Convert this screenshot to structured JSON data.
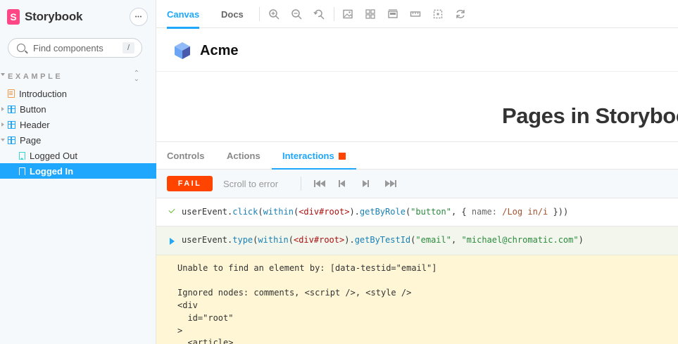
{
  "sidebar": {
    "brand": "Storybook",
    "brand_logo_letter": "S",
    "menu_glyph": "•••",
    "search_placeholder": "Find components",
    "search_shortcut": "/",
    "group_label": "EXAMPLE",
    "items": [
      {
        "label": "Introduction",
        "icon": "document-icon"
      },
      {
        "label": "Button",
        "icon": "component-icon"
      },
      {
        "label": "Header",
        "icon": "component-icon"
      },
      {
        "label": "Page",
        "icon": "component-icon"
      },
      {
        "label": "Logged Out",
        "icon": "story-icon"
      },
      {
        "label": "Logged In",
        "icon": "story-icon",
        "selected": true
      }
    ]
  },
  "toolbar": {
    "tabs": [
      {
        "label": "Canvas",
        "active": true
      },
      {
        "label": "Docs"
      }
    ],
    "icons": [
      "zoom-in-icon",
      "zoom-out-icon",
      "zoom-reset-icon",
      "background-icon",
      "grid-icon",
      "viewport-icon",
      "measure-icon",
      "outline-icon",
      "remount-icon"
    ]
  },
  "preview": {
    "app_name": "Acme",
    "heading": "Pages in Storybook"
  },
  "panel": {
    "tabs": [
      {
        "label": "Controls"
      },
      {
        "label": "Actions"
      },
      {
        "label": "Interactions",
        "active": true,
        "status": "error"
      }
    ],
    "status_badge": "FAIL",
    "scroll_to_error": "Scroll to error",
    "nav_buttons": [
      "go-to-start-icon",
      "step-back-icon",
      "step-forward-icon",
      "go-to-end-icon"
    ]
  },
  "interactions": {
    "step1": {
      "status": "pass",
      "a": "userEvent.",
      "b": "click",
      "c": "(",
      "d": "within",
      "e": "(",
      "f": "<div#root>",
      "g": ").",
      "h": "getByRole",
      "i": "(",
      "j": "\"button\"",
      "k": ", { ",
      "l": "name:",
      "m": " ",
      "n": "/Log in/i",
      "o": " }))"
    },
    "step2": {
      "status": "error",
      "a": "userEvent.",
      "b": "type",
      "c": "(",
      "d": "within",
      "e": "(",
      "f": "<div#root>",
      "g": ").",
      "h": "getByTestId",
      "i": "(",
      "j": "\"email\"",
      "k": ", ",
      "l": "\"michael@chromatic.com\"",
      "m": ")"
    },
    "error_lines": [
      "Unable to find an element by: [data-testid=\"email\"]",
      "",
      "Ignored nodes: comments, <script />, <style />",
      "<div",
      "  id=\"root\"",
      ">",
      "  <article>"
    ]
  },
  "colors": {
    "accent": "#1ea7fd",
    "fail": "#ff4400",
    "brand": "#ff4785",
    "pass": "#66bf3c"
  }
}
